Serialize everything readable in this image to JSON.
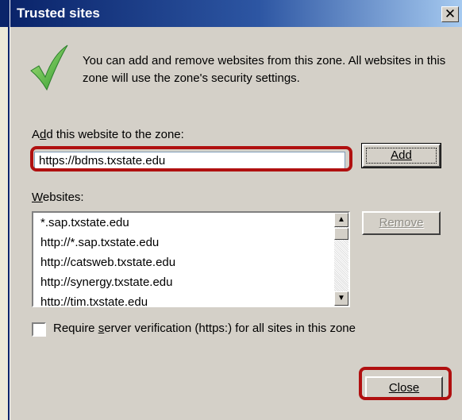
{
  "dialog": {
    "title": "Trusted sites",
    "close_glyph": "✕",
    "icon": "check-icon",
    "info_text": "You can add and remove websites from this zone. All websites in this zone will use the zone's security settings."
  },
  "add": {
    "label_pre": "A",
    "label_key": "d",
    "label_post": "d this website to the zone:",
    "input_value": "https://bdms.txstate.edu",
    "button_label": "Add"
  },
  "websites": {
    "label_key": "W",
    "label_post": "ebsites:",
    "items": [
      "*.sap.txstate.edu",
      "http://*.sap.txstate.edu",
      "http://catsweb.txstate.edu",
      "http://synergy.txstate.edu",
      "http://tim.txstate.edu"
    ],
    "remove_label": "Remove"
  },
  "verification": {
    "label_pre": "Require ",
    "label_key": "s",
    "label_post": "erver verification (https:) for all sites in this zone",
    "checked": false
  },
  "footer": {
    "close_label": "Close"
  },
  "colors": {
    "title_bar": "#0a246a",
    "highlight": "#b01010",
    "dialog_bg": "#d4d0c8"
  }
}
